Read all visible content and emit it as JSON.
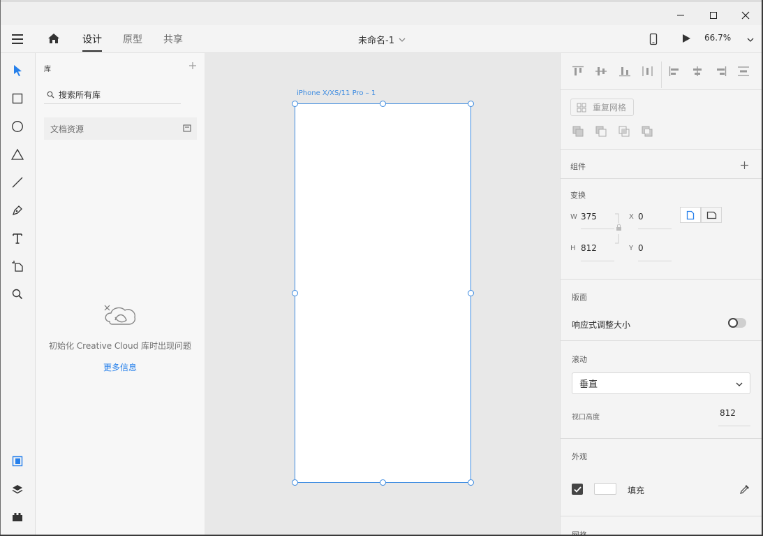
{
  "appbar": {
    "tabs": [
      {
        "label": "设计",
        "active": true
      },
      {
        "label": "原型",
        "active": false
      },
      {
        "label": "共享",
        "active": false
      }
    ],
    "doc_title": "未命名-1",
    "zoom": "66.7%"
  },
  "library": {
    "title": "库",
    "search_placeholder": "搜索所有库",
    "doc_assets": "文档资源",
    "error_message": "初始化 Creative Cloud 库时出现问题",
    "more_info": "更多信息"
  },
  "canvas": {
    "artboard_label": "iPhone X/XS/11 Pro – 1"
  },
  "properties": {
    "repeat_grid": "重复网格",
    "components": "组件",
    "transform": "变换",
    "w_label": "W",
    "w_value": "375",
    "x_label": "X",
    "x_value": "0",
    "h_label": "H",
    "h_value": "812",
    "y_label": "Y",
    "y_value": "0",
    "layout": "版面",
    "responsive_resize": "响应式调整大小",
    "responsive_on": false,
    "scroll": "滚动",
    "scroll_value": "垂直",
    "viewport_height_label": "视口高度",
    "viewport_height_value": "812",
    "appearance": "外观",
    "fill_label": "填充",
    "fill_checked": true,
    "fill_color": "#ffffff",
    "grid": "网格"
  },
  "colors": {
    "accent": "#2680eb",
    "selection": "#3b8ae0"
  }
}
